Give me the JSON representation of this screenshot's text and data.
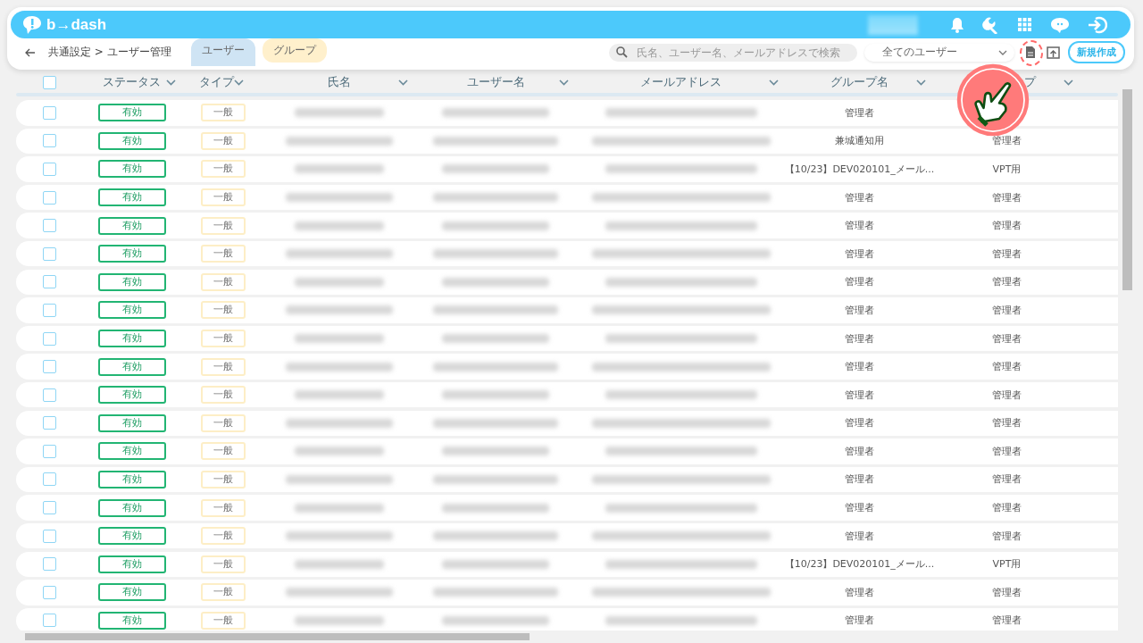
{
  "header": {
    "logo": "b→dash"
  },
  "toolbar": {
    "breadcrumb": "共通設定 > ユーザー管理",
    "tabs": [
      {
        "label": "ユーザー",
        "selected": true
      },
      {
        "label": "グループ",
        "selected": false
      }
    ],
    "search": {
      "placeholder": "氏名、ユーザー名、メールアドレスで検索"
    },
    "filter": {
      "value": "全てのユーザー"
    },
    "new_button": "新規作成"
  },
  "table": {
    "all_checked": false,
    "columns": [
      {
        "label": "ステータス"
      },
      {
        "label": "タイプ"
      },
      {
        "label": "氏名"
      },
      {
        "label": "ユーザー名"
      },
      {
        "label": "メールアドレス"
      },
      {
        "label": "グループ名"
      },
      {
        "label": "プ"
      }
    ],
    "rows": [
      {
        "checked": false,
        "status": "有効",
        "type": "一般",
        "group": "管理者"
      },
      {
        "checked": false,
        "status": "有効",
        "type": "一般",
        "group": "兼城通知用",
        "role": "管理者"
      },
      {
        "checked": false,
        "status": "有効",
        "type": "一般",
        "group": "【10/23】DEV020101_メール...",
        "role": "VPT用"
      },
      {
        "checked": false,
        "status": "有効",
        "type": "一般",
        "group": "管理者",
        "role": "管理者"
      },
      {
        "checked": false,
        "status": "有効",
        "type": "一般",
        "group": "管理者",
        "role": "管理者"
      },
      {
        "checked": false,
        "status": "有効",
        "type": "一般",
        "group": "管理者",
        "role": "管理者"
      },
      {
        "checked": false,
        "status": "有効",
        "type": "一般",
        "group": "管理者",
        "role": "管理者"
      },
      {
        "checked": false,
        "status": "有効",
        "type": "一般",
        "group": "管理者",
        "role": "管理者"
      },
      {
        "checked": false,
        "status": "有効",
        "type": "一般",
        "group": "管理者",
        "role": "管理者"
      },
      {
        "checked": false,
        "status": "有効",
        "type": "一般",
        "group": "管理者",
        "role": "管理者"
      },
      {
        "checked": false,
        "status": "有効",
        "type": "一般",
        "group": "管理者",
        "role": "管理者"
      },
      {
        "checked": false,
        "status": "有効",
        "type": "一般",
        "group": "管理者",
        "role": "管理者"
      },
      {
        "checked": false,
        "status": "有効",
        "type": "一般",
        "group": "管理者",
        "role": "管理者"
      },
      {
        "checked": false,
        "status": "有効",
        "type": "一般",
        "group": "管理者",
        "role": "管理者"
      },
      {
        "checked": false,
        "status": "有効",
        "type": "一般",
        "group": "管理者",
        "role": "管理者"
      },
      {
        "checked": false,
        "status": "有効",
        "type": "一般",
        "group": "管理者",
        "role": "管理者"
      },
      {
        "checked": false,
        "status": "有効",
        "type": "一般",
        "group": "【10/23】DEV020101_メール...",
        "role": "VPT用"
      },
      {
        "checked": false,
        "status": "有効",
        "type": "一般",
        "group": "管理者",
        "role": "管理者"
      },
      {
        "checked": false,
        "status": "有効",
        "type": "一般",
        "group": "管理者",
        "role": "管理者"
      }
    ]
  }
}
